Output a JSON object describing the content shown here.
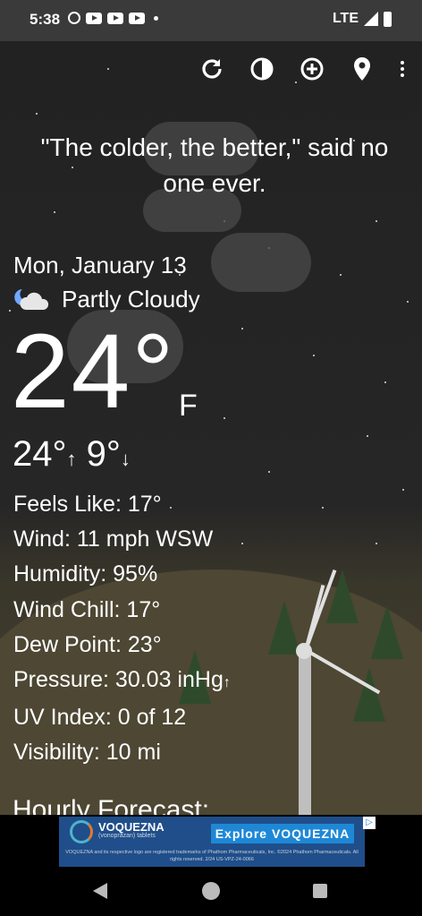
{
  "status_bar": {
    "time": "5:38",
    "network": "LTE"
  },
  "toolbar": {
    "icons": [
      "refresh-icon",
      "theme-icon",
      "add-icon",
      "location-icon",
      "more-icon"
    ]
  },
  "quote": "\"The colder, the better,\" said no one ever.",
  "current": {
    "date": "Mon, January 13",
    "condition": "Partly Cloudy",
    "temperature": "24°",
    "unit": "F",
    "high": "24°",
    "low": "9°",
    "high_arrow": "↑",
    "low_arrow": "↓"
  },
  "details": {
    "feels_like": "Feels Like:  17°",
    "wind": "Wind:  11 mph WSW",
    "humidity": "Humidity:  95%",
    "wind_chill": "Wind Chill:  17°",
    "dew_point": "Dew Point:  23°",
    "pressure": "Pressure:  30.03 inHg",
    "pressure_trend": "↑",
    "uv_index": "UV Index:  0 of 12",
    "visibility": "Visibility:  10 mi"
  },
  "hourly_heading": "Hourly Forecast:",
  "ad": {
    "brand": "VOQUEZNA",
    "sub": "(vonoprazan) tablets",
    "button": "Explore VOQUEZNA",
    "legal": "VOQUEZNA and its respective logo are registered trademarks of Phathom Pharmaceuticals, Inc. ©2024 Phathom Pharmaceuticals. All rights reserved. 2/24 US-VPZ-24-0066"
  }
}
